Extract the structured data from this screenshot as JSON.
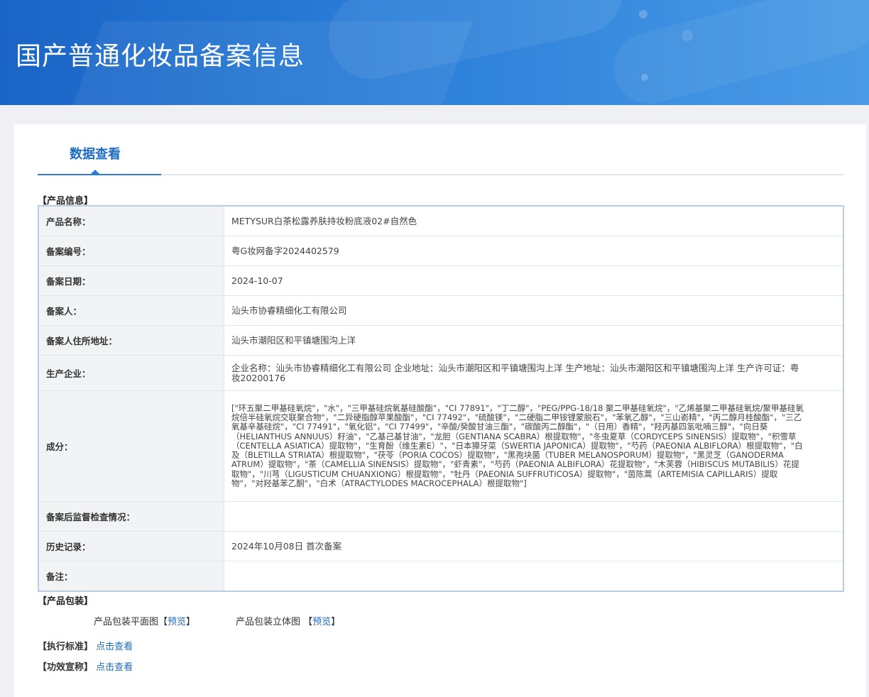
{
  "header": {
    "title": "国产普通化妆品备案信息"
  },
  "tabs": [
    {
      "label": "数据查看"
    }
  ],
  "sections": {
    "product_info": "【产品信息】",
    "packaging": "【产品包装】",
    "standard": "【执行标准】",
    "efficacy": "【功效宣称】"
  },
  "table": [
    {
      "label": "产品名称：",
      "value": "METYSUR白茶松露养肤持妆粉底液02#自然色"
    },
    {
      "label": "备案编号：",
      "value": "粤G妆网备字2024402579"
    },
    {
      "label": "备案日期：",
      "value": "2024-10-07"
    },
    {
      "label": "备案人：",
      "value": "汕头市协睿精细化工有限公司"
    },
    {
      "label": "备案人住所地址：",
      "value": "汕头市潮阳区和平镇塘围沟上洋"
    },
    {
      "label": "生产企业：",
      "value": "企业名称：汕头市协睿精细化工有限公司 企业地址：汕头市潮阳区和平镇塘围沟上洋 生产地址：汕头市潮阳区和平镇塘围沟上洋 生产许可证：粤妆20200176"
    },
    {
      "label": "成分：",
      "value": "[\"环五聚二甲基硅氧烷\"，\"水\"，\"三甲基硅烷氧基硅酸酯\"，\"CI 77891\"，\"丁二醇\"，\"PEG/PPG-18/18 聚二甲基硅氧烷\"，\"乙烯基聚二甲基硅氧烷/聚甲基硅氧烷倍半硅氧烷交联聚合物\"，\"二异硬脂醇苹果酸酯\"，\"CI 77492\"，\"硫酸镁\"，\"二硬脂二甲铵锂蒙脱石\"，\"苯氧乙醇\"，\"三山嵛精\"，\"丙二醇月桂酸酯\"，\"三乙氧基辛基硅烷\"，\"CI 77491\"，\"氧化铝\"，\"CI 77499\"，\"辛酸/癸酸甘油三酯\"，\"碳酸丙二醇酯\"，\"（日用）香精\"，\"羟丙基四氢吡喃三醇\"，\"向日葵（HELIANTHUS ANNUUS）籽油\"，\"乙基己基甘油\"，\"龙胆（GENTIANA SCABRA）根提取物\"，\"冬虫夏草（CORDYCEPS SINENSIS）提取物\"，\"积雪草（CENTELLA ASIATICA）提取物\"，\"生育酚（维生素E）\"，\"日本獐牙菜（SWERTIA JAPONICA）提取物\"，\"芍药（PAEONIA ALBIFLORA）根提取物\"，\"白及（BLETILLA STRIATA）根提取物\"，\"茯苓（PORIA COCOS）提取物\"，\"黑孢块菌（TUBER MELANOSPORUM）提取物\"，\"黑灵芝（GANODERMA ATRUM）提取物\"，\"茶（CAMELLIA SINENSIS）提取物\"，\"虾青素\"，\"芍药（PAEONIA ALBIFLORA）花提取物\"，\"木芙蓉（HIBISCUS MUTABILIS）花提取物\"，\"川芎（LIGUSTICUM CHUANXIONG）根提取物\"，\"牡丹（PAEONIA SUFFRUTICOSA）提取物\"，\"茵陈蒿（ARTEMISIA CAPILLARIS）提取物\"，\"对羟基苯乙酮\"，\"白术（ATRACTYLODES MACROCEPHALA）根提取物\"]"
    },
    {
      "label": "备案后监督检查情况：",
      "value": ""
    },
    {
      "label": "历史记录：",
      "value": "2024年10月08日 首次备案"
    },
    {
      "label": "备注：",
      "value": ""
    }
  ],
  "packaging": {
    "flat_label": "产品包装平面图",
    "stereo_label": "产品包装立体图",
    "bracket_open": "【",
    "bracket_close": "】",
    "preview": "预览"
  },
  "links": {
    "view": "点击查看"
  }
}
